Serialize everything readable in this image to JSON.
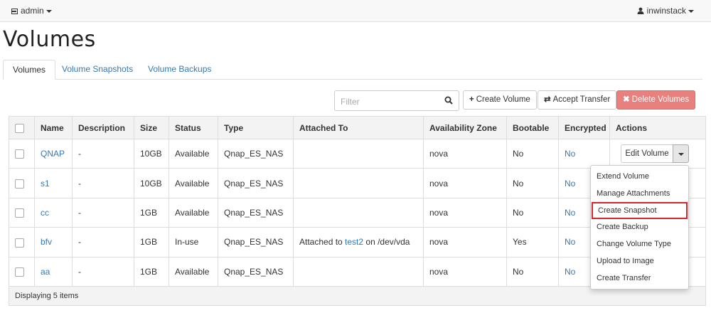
{
  "nav": {
    "project": "admin",
    "user": "inwinstack"
  },
  "page": {
    "title": "Volumes"
  },
  "tabs": [
    {
      "label": "Volumes",
      "active": true
    },
    {
      "label": "Volume Snapshots",
      "active": false
    },
    {
      "label": "Volume Backups",
      "active": false
    }
  ],
  "toolbar": {
    "filter_placeholder": "Filter",
    "create_label": "Create Volume",
    "accept_label": "Accept Transfer",
    "delete_label": "Delete Volumes"
  },
  "table": {
    "headers": [
      "Name",
      "Description",
      "Size",
      "Status",
      "Type",
      "Attached To",
      "Availability Zone",
      "Bootable",
      "Encrypted",
      "Actions"
    ],
    "rows": [
      {
        "name": "QNAP",
        "description": "-",
        "size": "10GB",
        "status": "Available",
        "type": "Qnap_ES_NAS",
        "attached_prefix": "",
        "attached_link": "",
        "attached_suffix": "",
        "zone": "nova",
        "bootable": "No",
        "encrypted": "No"
      },
      {
        "name": "s1",
        "description": "-",
        "size": "10GB",
        "status": "Available",
        "type": "Qnap_ES_NAS",
        "attached_prefix": "",
        "attached_link": "",
        "attached_suffix": "",
        "zone": "nova",
        "bootable": "No",
        "encrypted": "No"
      },
      {
        "name": "cc",
        "description": "-",
        "size": "1GB",
        "status": "Available",
        "type": "Qnap_ES_NAS",
        "attached_prefix": "",
        "attached_link": "",
        "attached_suffix": "",
        "zone": "nova",
        "bootable": "No",
        "encrypted": "No"
      },
      {
        "name": "bfv",
        "description": "-",
        "size": "1GB",
        "status": "In-use",
        "type": "Qnap_ES_NAS",
        "attached_prefix": "Attached to ",
        "attached_link": "test2",
        "attached_suffix": " on /dev/vda",
        "zone": "nova",
        "bootable": "Yes",
        "encrypted": "No"
      },
      {
        "name": "aa",
        "description": "-",
        "size": "1GB",
        "status": "Available",
        "type": "Qnap_ES_NAS",
        "attached_prefix": "",
        "attached_link": "",
        "attached_suffix": "",
        "zone": "nova",
        "bootable": "No",
        "encrypted": "No"
      }
    ],
    "footer": "Displaying 5 items"
  },
  "row_action": {
    "label": "Edit Volume"
  },
  "dropdown": {
    "items": [
      "Extend Volume",
      "Manage Attachments",
      "Create Snapshot",
      "Create Backup",
      "Change Volume Type",
      "Upload to Image",
      "Create Transfer"
    ],
    "highlighted": "Create Snapshot",
    "highlight_color": "#d9232d"
  },
  "colors": {
    "link": "#337ab7",
    "danger": "#e8807d"
  }
}
